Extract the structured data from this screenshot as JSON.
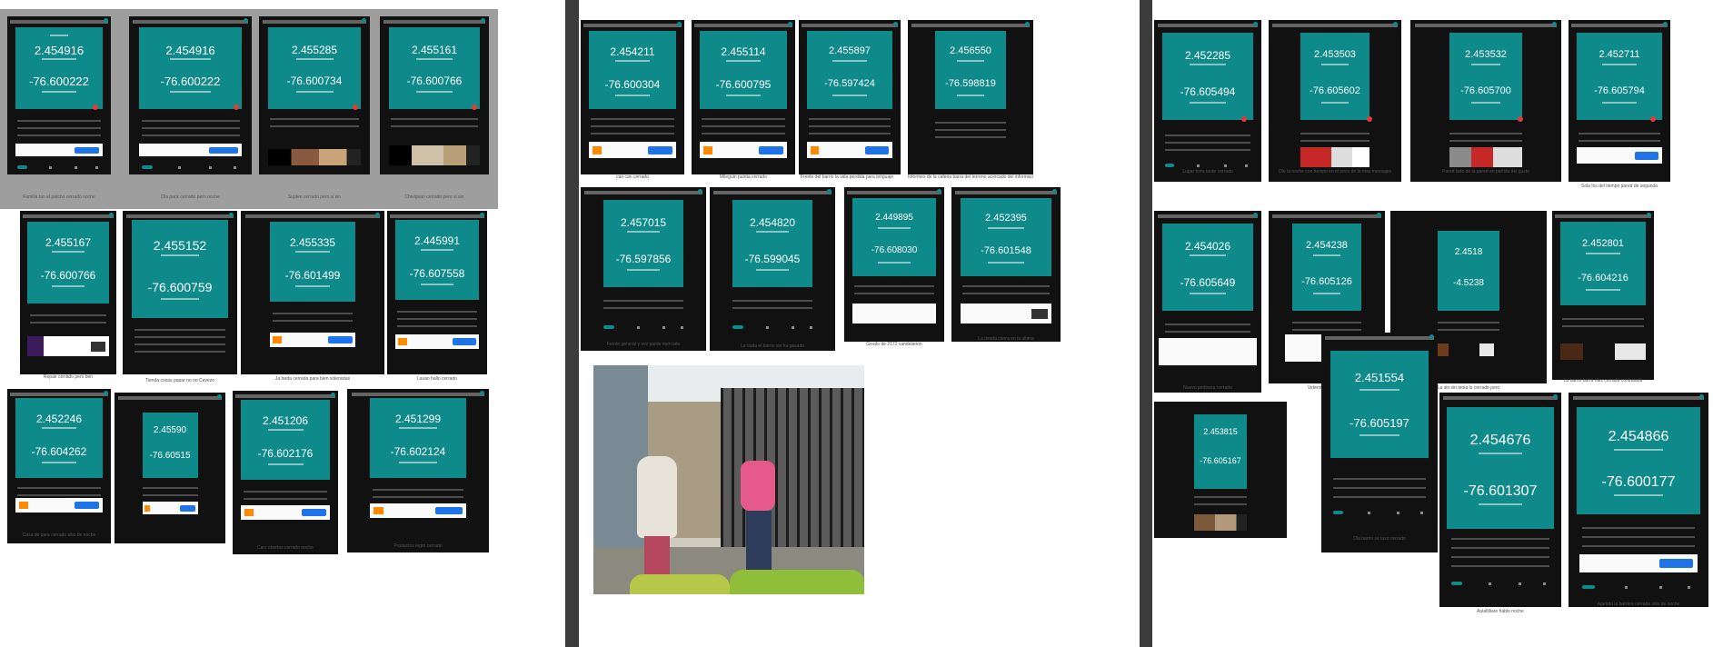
{
  "panel1": {
    "captions": [
      "Familia tan el patcho cerrado noche",
      "Ola pack cerrado pero noche",
      "Suplen cerrado pero si sin",
      "Chiviguan cerrado pero si sin",
      "Repair cerrado pero ben",
      "Tienda cosas papar no no Cevezo",
      "Ja tarda cerrada para bien solenistas",
      "Lavan hallo cerrado",
      "Casa de para cerrado sitio de noche",
      "Cars obertos cerrado noche",
      "Productos legro cerrado"
    ],
    "screens": [
      {
        "lat": "2.454916",
        "lon": "-76.600222"
      },
      {
        "lat": "2.454916",
        "lon": "-76.600222"
      },
      {
        "lat": "2.455285",
        "lon": "-76.600734"
      },
      {
        "lat": "2.455161",
        "lon": "-76.600766"
      },
      {
        "lat": "2.455167",
        "lon": "-76.600766"
      },
      {
        "lat": "2.455152",
        "lon": "-76.600759"
      },
      {
        "lat": "2.455335",
        "lon": "-76.601499"
      },
      {
        "lat": "2.445991",
        "lon": "-76.607558"
      },
      {
        "lat": "2.452246",
        "lon": "-76.604262"
      },
      {
        "lat": "2.45590",
        "lon": "-76.60515"
      },
      {
        "lat": "2.451206",
        "lon": "-76.602176"
      },
      {
        "lat": "2.451299",
        "lon": "-76.602124"
      }
    ]
  },
  "panel2": {
    "captions": [
      "can can cerrado",
      "Mileguin pantia cerrado",
      "Frente del barrio la vida perdida para lenguaje",
      "Informes de la caferia barra del terreno acercado del informacion",
      "Frente general y vez parde mercado",
      "La duda el barrio sin ha pasado",
      "Gesdo de 2172 candelarion",
      "La tienda cierra en la altima"
    ],
    "screens": [
      {
        "lat": "2.454211",
        "lon": "-76.600304"
      },
      {
        "lat": "2.455114",
        "lon": "-76.600795"
      },
      {
        "lat": "2.455897",
        "lon": "-76.597424"
      },
      {
        "lat": "2.456550",
        "lon": "-76.598819"
      },
      {
        "lat": "2.457015",
        "lon": "-76.597856"
      },
      {
        "lat": "2.454820",
        "lon": "-76.599045"
      },
      {
        "lat": "2.449895",
        "lon": "-76.608030"
      },
      {
        "lat": "2.452395",
        "lon": "-76.601548"
      }
    ]
  },
  "panel3": {
    "captions": [
      "Lugar hora tarde cerrado",
      "Ole la noche con tiempo en el poco de la mas mensajes",
      "Pared lado de la pared en partida del gusto",
      "Sola los del tiempo pared de segunda",
      "Nuevo jardinera cerrado",
      "Veterinaria cerrada",
      "La sin sin tenia lo cerrado pero",
      "La barrio barra diez cerrada contratada",
      "Ola barrio se tuvo cerrado",
      "Aulafilliare hablo noche",
      "Agenda la barrera cerrada sitio de noche"
    ],
    "screens": [
      {
        "lat": "2.452285",
        "lon": "-76.605494"
      },
      {
        "lat": "2.453503",
        "lon": "-76.605602"
      },
      {
        "lat": "2.453532",
        "lon": "-76.605700"
      },
      {
        "lat": "2.452711",
        "lon": "-76.605794"
      },
      {
        "lat": "2.454026",
        "lon": "-76.605649"
      },
      {
        "lat": "2.454238",
        "lon": "-76.605126"
      },
      {
        "lat": "2.4518",
        "lon": "-4.5238"
      },
      {
        "lat": "2.452801",
        "lon": "-76.604216"
      },
      {
        "lat": "2.453815",
        "lon": "-76.605167"
      },
      {
        "lat": "2.451554",
        "lon": "-76.605197"
      },
      {
        "lat": "2.454676",
        "lon": "-76.601307"
      },
      {
        "lat": "2.454866",
        "lon": "-76.600177"
      }
    ]
  }
}
